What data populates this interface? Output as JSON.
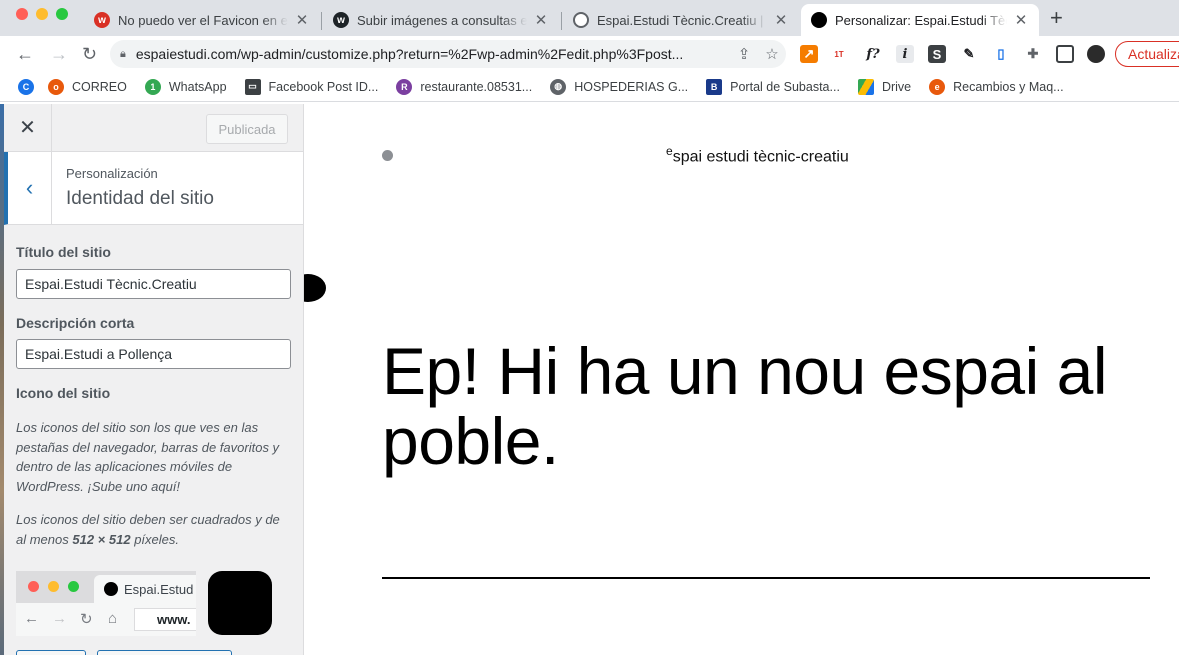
{
  "browser": {
    "tabs": [
      {
        "title": "No puedo ver el Favicon en el c",
        "favicon_color": "#d93025",
        "favicon_glyph": "w",
        "active": false
      },
      {
        "title": "Subir imágenes a consultas en",
        "favicon_color": "#1d2327",
        "favicon_glyph": "w",
        "active": false
      },
      {
        "title": "Espai.Estudi Tècnic.Creatiu | Es",
        "favicon_color": "#5f6368",
        "favicon_glyph": "globe",
        "active": false
      },
      {
        "title": "Personalizar: Espai.Estudi Tècni",
        "favicon_color": "#000000",
        "favicon_glyph": "dot",
        "active": true
      }
    ],
    "new_tab_glyph": "+",
    "address": "espaiestudi.com/wp-admin/customize.php?return=%2Fwp-admin%2Fedit.php%3Fpost...",
    "update_label": "Actualizar",
    "bookmarks": [
      {
        "label": "",
        "icon": "c-circle-icon",
        "color": "#1a73e8"
      },
      {
        "label": "CORREO",
        "icon": "mail-logo-icon",
        "color": "#e8590c"
      },
      {
        "label": "WhatsApp",
        "icon": "whatsapp-icon",
        "color": "#34a853"
      },
      {
        "label": "Facebook Post ID...",
        "icon": "comment-icon",
        "color": "#3c4043"
      },
      {
        "label": "restaurante.08531...",
        "icon": "restaurant-icon",
        "color": "#7b3fa0"
      },
      {
        "label": "HOSPEDERIAS G...",
        "icon": "globe-icon",
        "color": "#5f6368"
      },
      {
        "label": "Portal de Subasta...",
        "icon": "boe-icon",
        "color": "#1a3a8a"
      },
      {
        "label": "Drive",
        "icon": "drive-icon",
        "color": "#fbbc04"
      },
      {
        "label": "Recambios y Maq...",
        "icon": "e-logo-icon",
        "color": "#e8590c"
      }
    ]
  },
  "customizer": {
    "close_glyph": "✕",
    "publish_label": "Publicada",
    "section_context": "Personalización",
    "section_title": "Identidad del sitio",
    "site_title_label": "Título del sitio",
    "site_title_value": "Espai.Estudi Tècnic.Creatiu",
    "tagline_label": "Descripción corta",
    "tagline_value": "Espai.Estudi a Pollença",
    "icon_label": "Icono del sitio",
    "icon_desc_1": "Los iconos del sitio son los que ves en las pestañas del navegador, barras de favoritos y dentro de las aplicaciones móviles de WordPress. ¡Sube uno aquí!",
    "icon_desc_2_prefix": "Los iconos del sitio deben ser cuadrados y de al menos ",
    "icon_desc_2_size": "512 × 512",
    "icon_desc_2_suffix": " píxeles.",
    "preview_tab_title": "Espai.Estud",
    "preview_url": "www."
  },
  "preview": {
    "site_title_small": "e",
    "site_title_rest": "spai estudi tècnic-creatiu",
    "heading": "Ep! Hi ha un nou espai al poble."
  },
  "colors": {
    "wp_blue": "#2271b1",
    "update_red": "#d93025"
  }
}
